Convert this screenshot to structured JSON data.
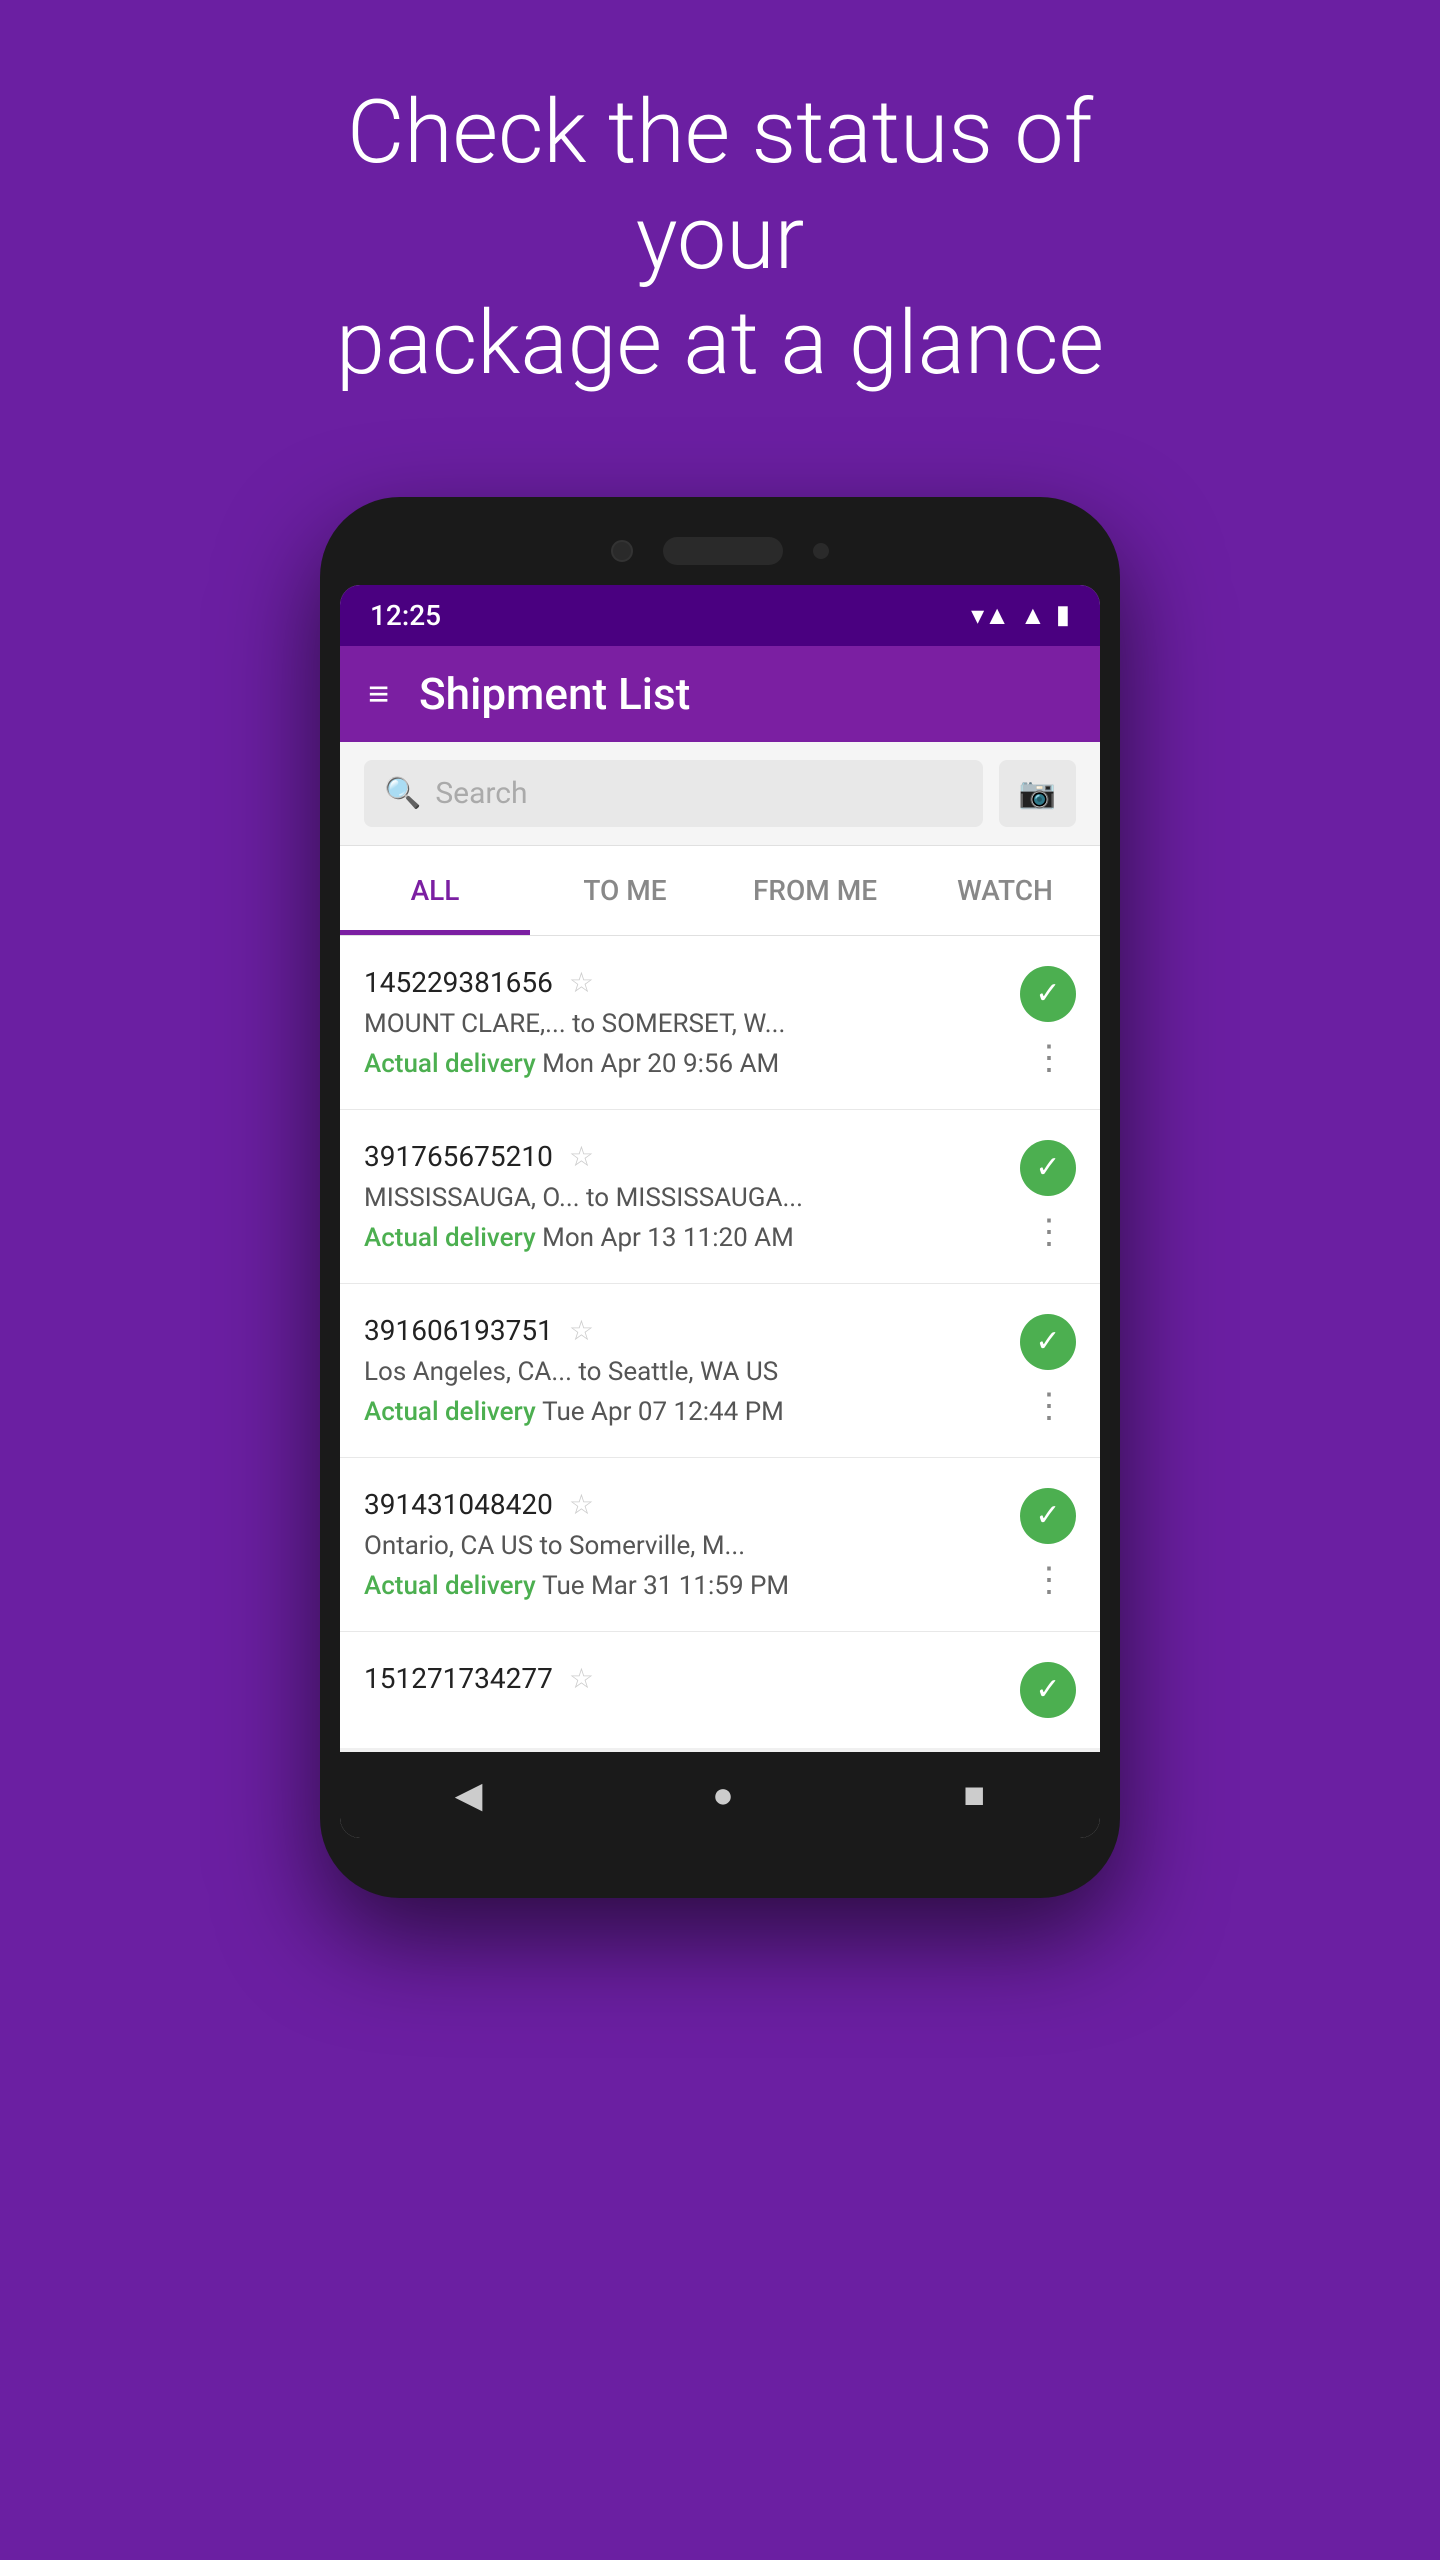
{
  "hero": {
    "line1": "Check the status of your",
    "line2": "package at a glance"
  },
  "status_bar": {
    "time": "12:25",
    "wifi": "▼",
    "signal": "▲",
    "battery": "🔋"
  },
  "toolbar": {
    "title": "Shipment List",
    "menu_icon": "≡"
  },
  "search": {
    "placeholder": "Search",
    "camera_label": "📷"
  },
  "tabs": [
    {
      "label": "ALL",
      "active": true
    },
    {
      "label": "TO ME",
      "active": false
    },
    {
      "label": "FROM ME",
      "active": false
    },
    {
      "label": "WATCH",
      "active": false
    }
  ],
  "shipments": [
    {
      "tracking": "145229381656",
      "route": "MOUNT CLARE,...    to SOMERSET, W...",
      "status_label": "Actual delivery",
      "date": "Mon Apr 20 9:56 AM",
      "delivered": true
    },
    {
      "tracking": "391765675210",
      "route": "MISSISSAUGA, O...  to MISSISSAUGA...",
      "status_label": "Actual delivery",
      "date": "Mon Apr 13 11:20 AM",
      "delivered": true
    },
    {
      "tracking": "391606193751",
      "route": "Los Angeles, CA...    to Seattle, WA US",
      "status_label": "Actual delivery",
      "date": "Tue Apr 07 12:44 PM",
      "delivered": true
    },
    {
      "tracking": "391431048420",
      "route": "Ontario, CA US to Somerville, M...",
      "status_label": "Actual delivery",
      "date": "Tue Mar 31 11:59 PM",
      "delivered": true
    },
    {
      "tracking": "151271734277",
      "route": "",
      "status_label": "",
      "date": "",
      "delivered": true,
      "partial": true
    }
  ],
  "nav": {
    "back": "◀",
    "home": "●",
    "recent": "■"
  }
}
